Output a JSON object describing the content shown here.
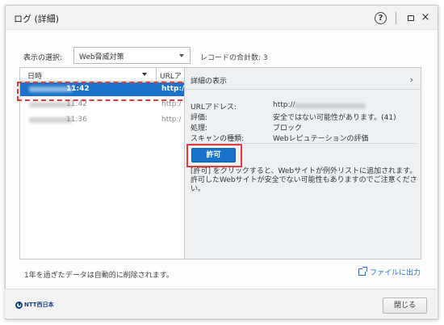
{
  "window": {
    "title": "ログ (詳細)",
    "help_icon": "?",
    "maximize_icon": "maximize-icon",
    "close_icon": "×"
  },
  "filter": {
    "label": "表示の選択:",
    "selected": "Web脅威対策",
    "record_count": "レコードの合計数: 3"
  },
  "list": {
    "columns": {
      "date": "日時",
      "url": "URLア"
    },
    "rows": [
      {
        "time": "11:42",
        "url": "http:/",
        "selected": true
      },
      {
        "time": "11:42",
        "url": "http:/",
        "selected": false
      },
      {
        "time": "11:36",
        "url": "http:/",
        "selected": false
      }
    ]
  },
  "detail": {
    "title": "詳細の表示",
    "chevron": "›",
    "fields": [
      {
        "key": "URLアドレス:",
        "value": "http://"
      },
      {
        "key": "評価:",
        "value": "安全ではない可能性があります。(41)"
      },
      {
        "key": "処理:",
        "value": "ブロック"
      },
      {
        "key": "スキャンの種類:",
        "value": "Webレピュテーションの評価"
      }
    ],
    "allow_button": "許可",
    "allow_note": "[許可] をクリックすると、Webサイトが例外リストに追加されます。許可したWebサイトが安全でない可能性もありますのでご注意ください。"
  },
  "footer": {
    "note": "1年を過ぎたデータは自動的に削除されます。",
    "export": "ファイルに出力"
  },
  "bottom": {
    "logo": "NTT西日本",
    "close": "閉じる"
  },
  "colors": {
    "accent": "#1a73c9",
    "highlight": "#e23a3a"
  }
}
